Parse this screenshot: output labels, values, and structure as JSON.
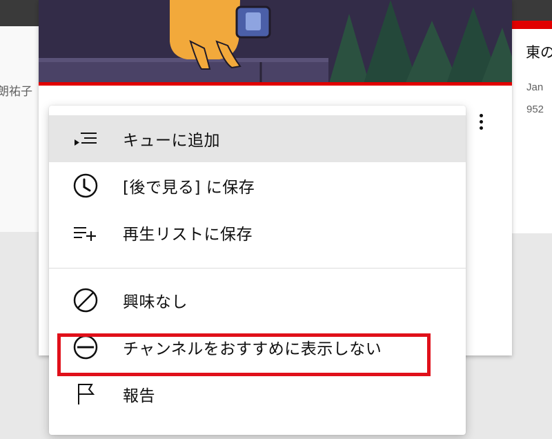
{
  "background": {
    "left_fragment": "朗祐子",
    "right_card": {
      "title_fragment": "東の",
      "meta_line_1": "Jan",
      "meta_line_2": "952"
    }
  },
  "video_card": {
    "more_actions_icon": "vertical-ellipsis-icon"
  },
  "context_menu": {
    "items": [
      {
        "label": "キューに追加",
        "icon": "add-to-queue-icon",
        "highlighted": true
      },
      {
        "label": "[後で見る] に保存",
        "icon": "clock-icon"
      },
      {
        "label": "再生リストに保存",
        "icon": "playlist-add-icon"
      },
      {
        "label": "興味なし",
        "icon": "prohibited-icon"
      },
      {
        "label": "チャンネルをおすすめに表示しない",
        "icon": "minus-circle-icon",
        "annotated": true
      },
      {
        "label": "報告",
        "icon": "flag-icon"
      }
    ]
  },
  "colors": {
    "annotation_red": "#e0101a",
    "accent_red": "#e00000",
    "highlight_grey": "#e5e5e5",
    "text": "#0f0f0f"
  }
}
